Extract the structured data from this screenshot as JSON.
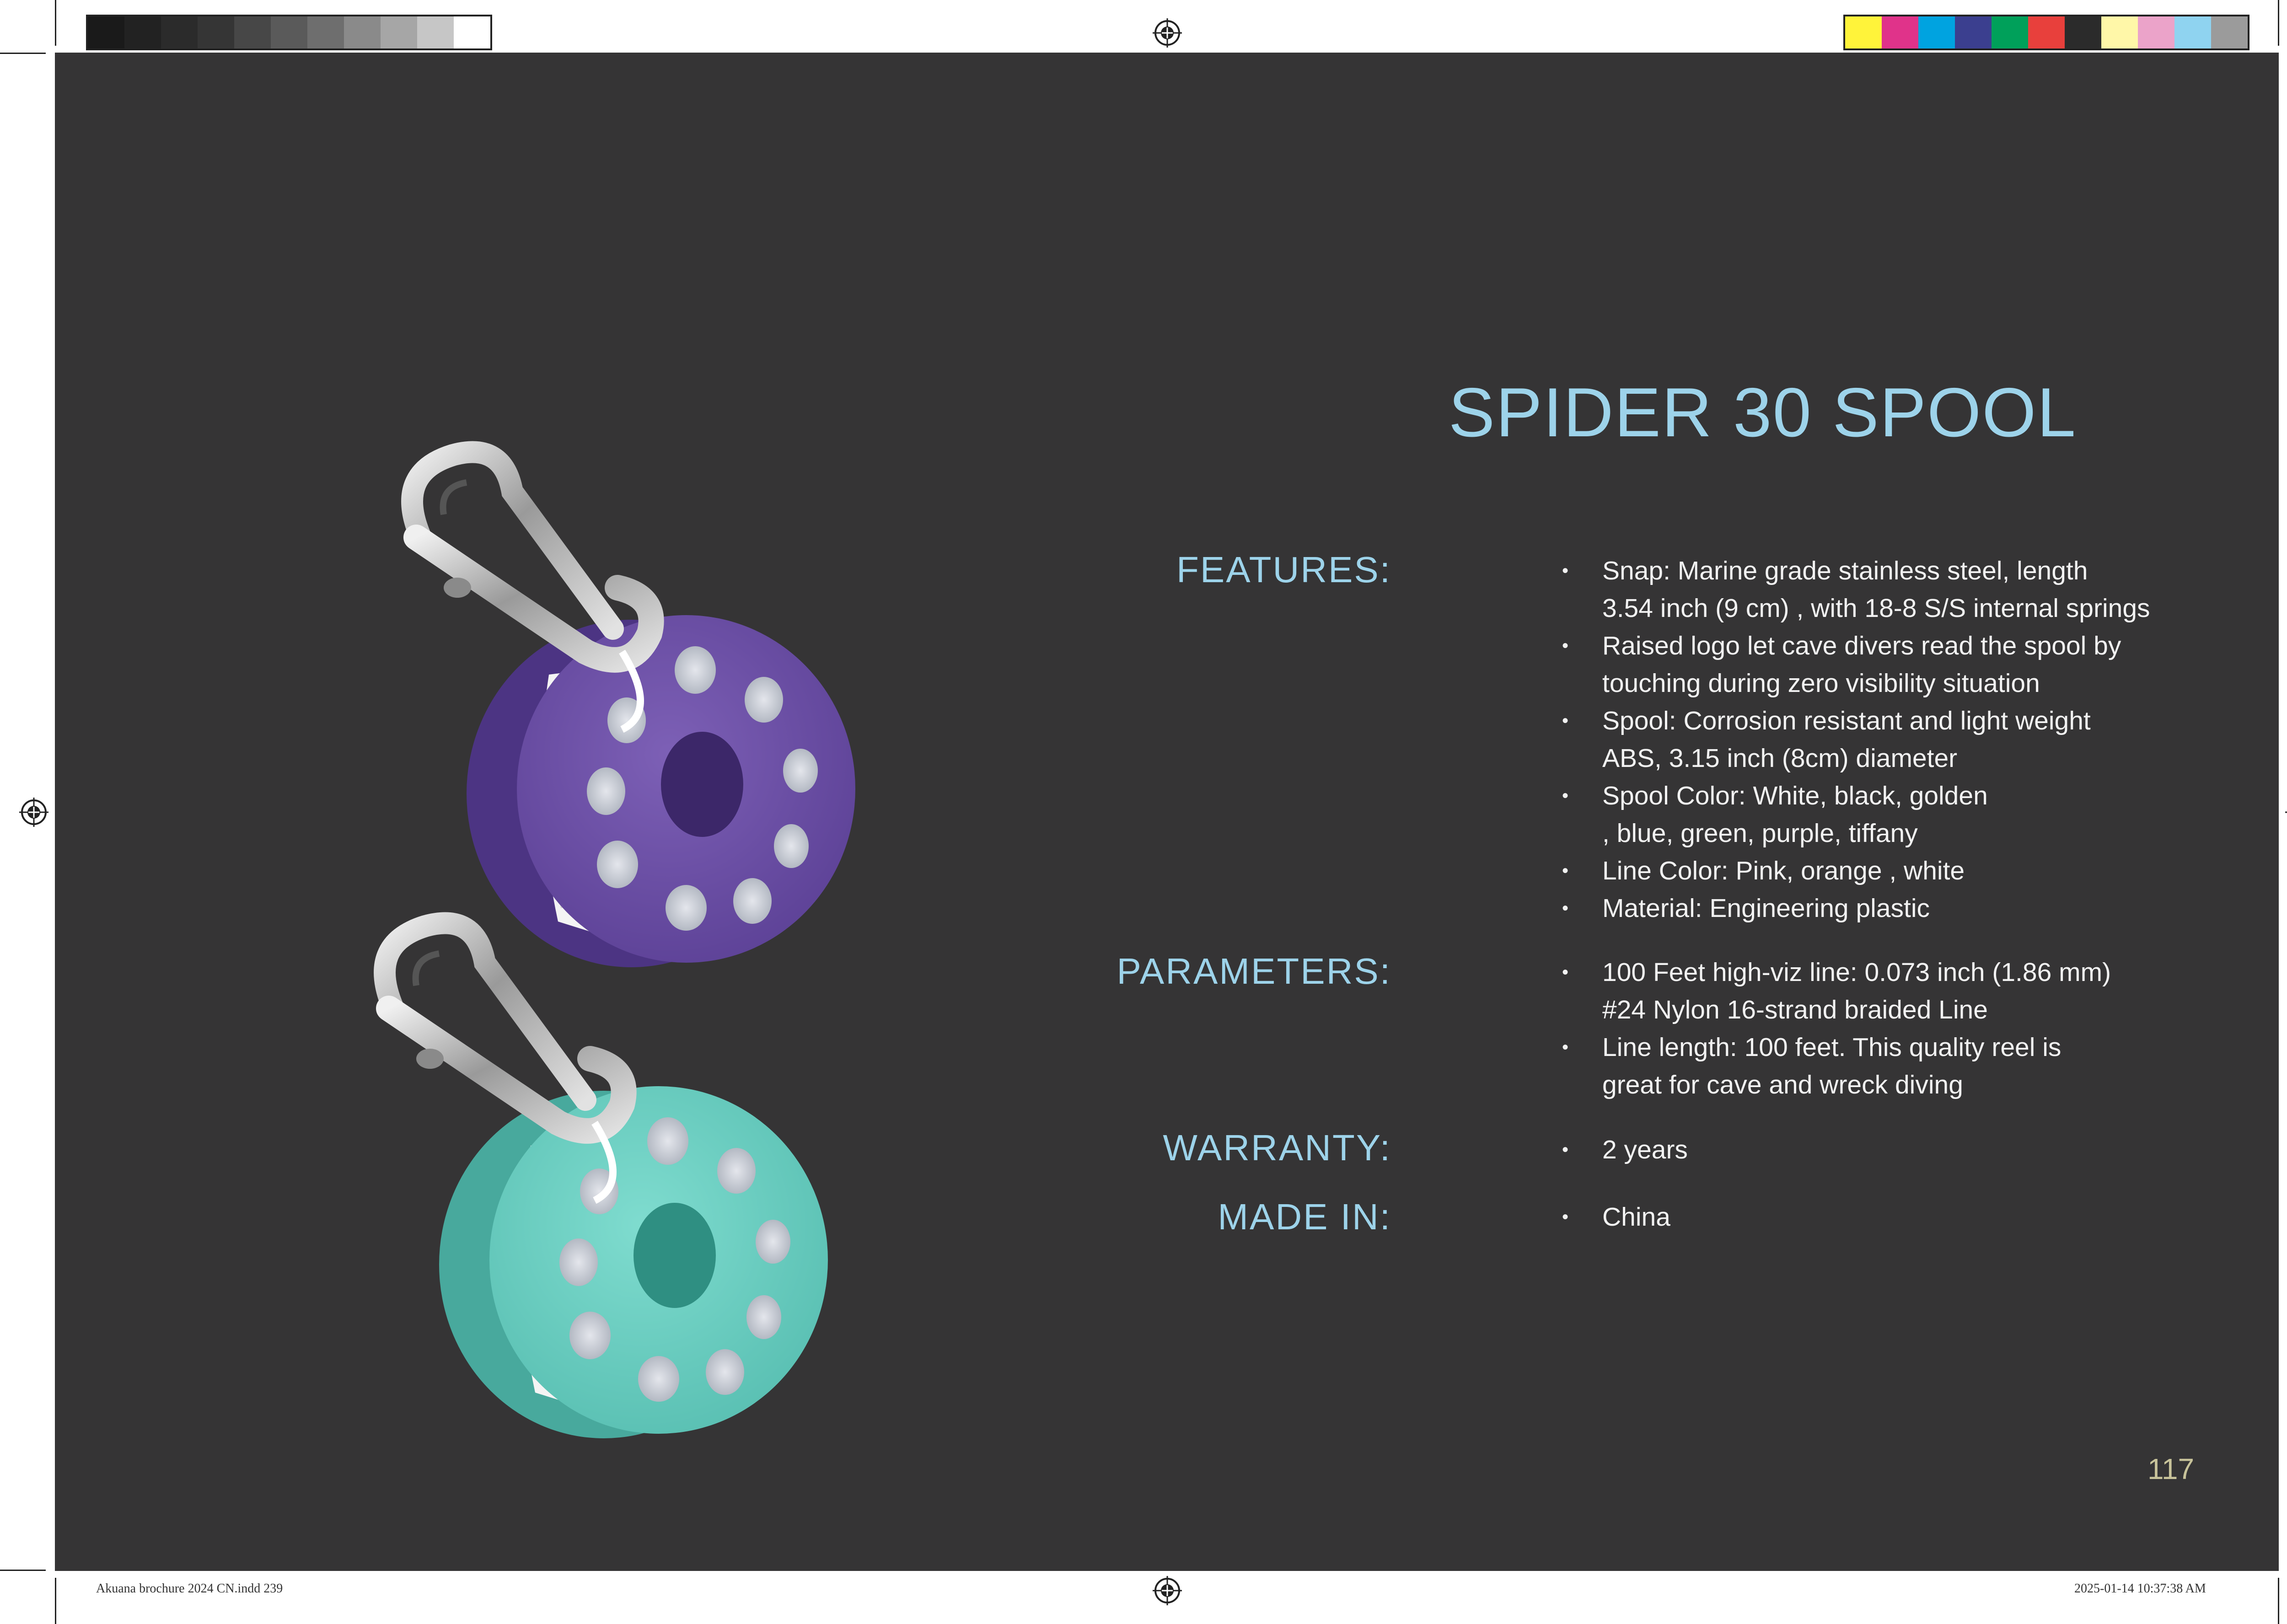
{
  "product": {
    "title": "SPIDER 30 SPOOL"
  },
  "sections": {
    "features": {
      "label": "FEATURES:",
      "items": [
        {
          "line1": "Snap: Marine grade stainless steel, length",
          "line2": "3.54 inch (9 cm) , with 18-8 S/S internal springs"
        },
        {
          "line1": "Raised logo let cave divers read the spool by",
          "line2": "touching during zero visibility situation"
        },
        {
          "line1": "Spool: Corrosion resistant and light weight",
          "line2": "ABS, 3.15 inch (8cm) diameter"
        },
        {
          "line1": "Spool Color: White, black, golden",
          "line2": ", blue, green, purple, tiffany"
        },
        {
          "line1": "Line Color: Pink, orange , white"
        },
        {
          "line1": "Material: Engineering plastic"
        }
      ]
    },
    "parameters": {
      "label": "PARAMETERS:",
      "items": [
        {
          "line1": "100 Feet high-viz line: 0.073 inch (1.86 mm)",
          "line2": "#24 Nylon 16-strand braided Line"
        },
        {
          "line1": "Line length: 100 feet. This quality reel is",
          "line2": "great for cave and wreck diving"
        }
      ]
    },
    "warranty": {
      "label": "WARRANTY:",
      "items": [
        {
          "line1": "2 years"
        }
      ]
    },
    "made_in": {
      "label": "MADE IN:",
      "items": [
        {
          "line1": "China"
        }
      ]
    }
  },
  "bullet_char": "•",
  "page_number": "117",
  "slug": {
    "left": "Akuana brochure 2024 CN.indd   239",
    "right": "2025-01-14   10:37:38 AM"
  },
  "colors": {
    "background": "#353435",
    "accent": "#9dd3ea",
    "body_text": "#f2f2f2",
    "page_number": "#c8c39a",
    "spool_purple": "#6c4fa4",
    "spool_tiffany": "#6ccfc3"
  },
  "color_bars": {
    "grayscale": [
      "#1a1a1a",
      "#222222",
      "#2b2b2b",
      "#353535",
      "#474747",
      "#5a5a5a",
      "#6e6e6e",
      "#8a8a8a",
      "#a6a6a6",
      "#c6c6c6",
      "#ffffff"
    ],
    "process": [
      "#fff33a",
      "#e0338a",
      "#00a3e0",
      "#3b3f8f",
      "#00a05a",
      "#e8403c",
      "#2b2b2b",
      "#fff7a8",
      "#eba3c9",
      "#8fd3f0",
      "#9b9b9b"
    ]
  }
}
